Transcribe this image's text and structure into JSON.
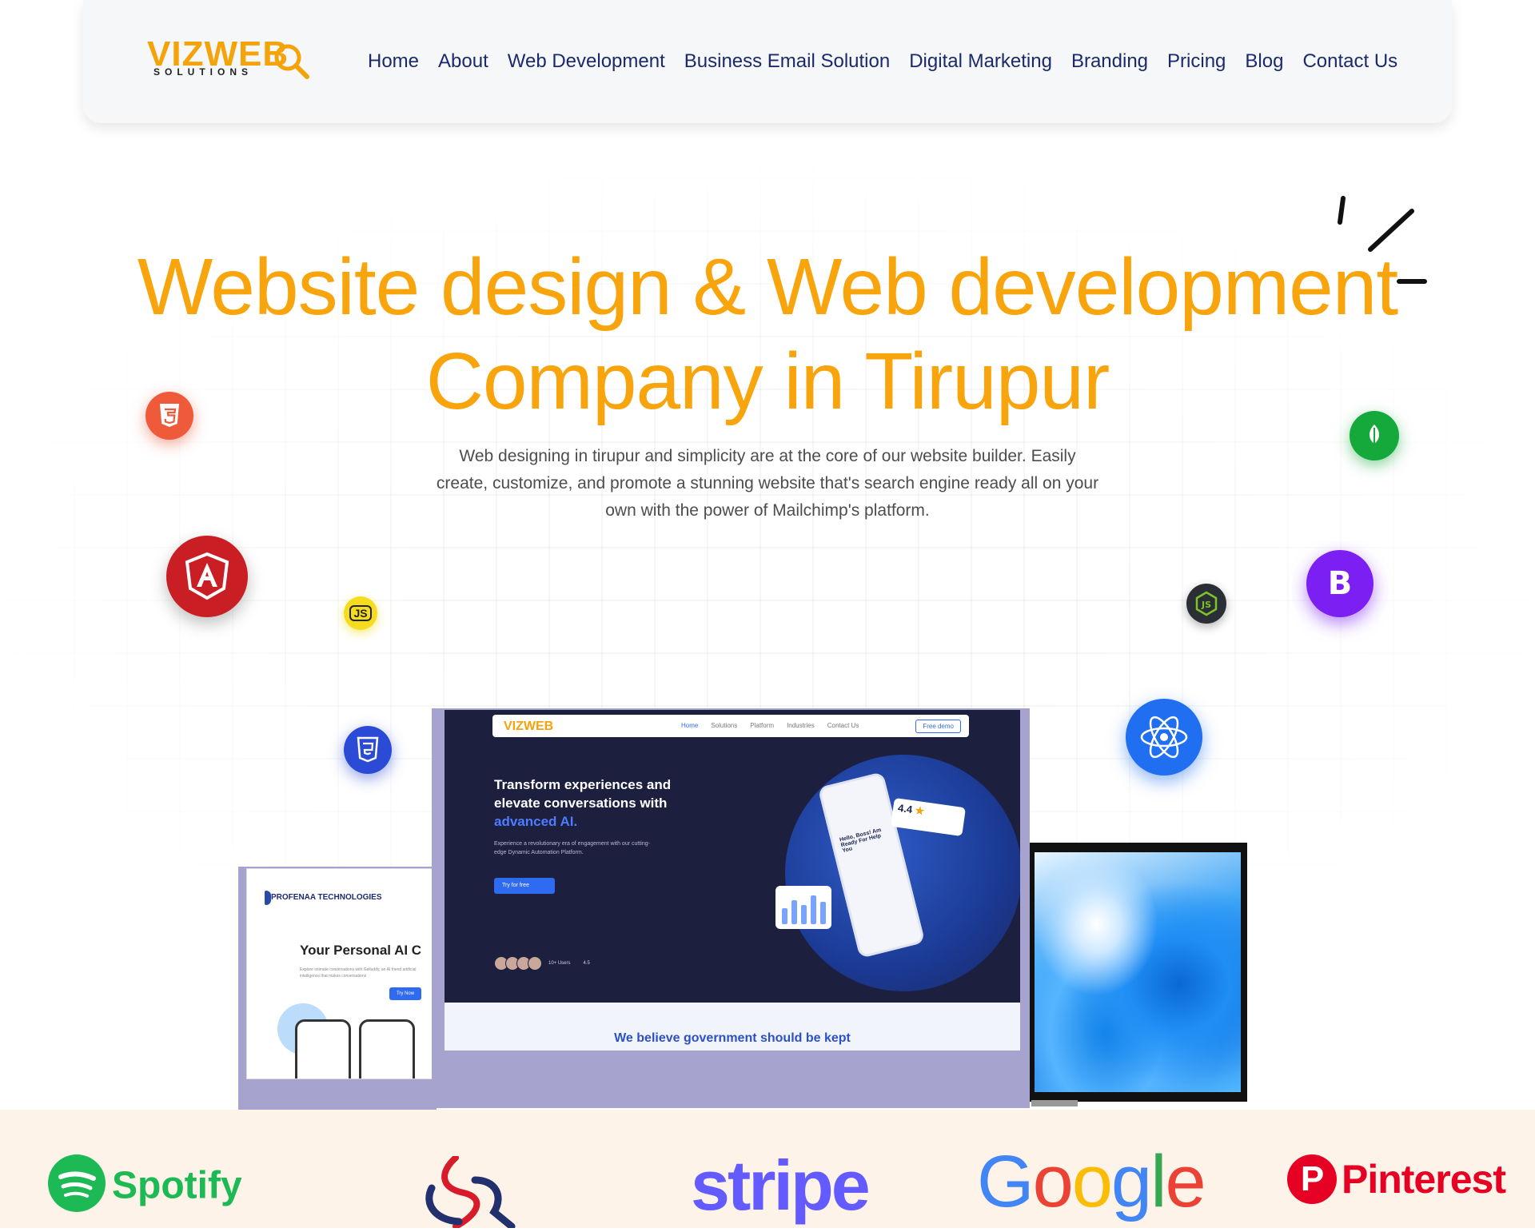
{
  "brand": {
    "logo_text": "VIZWEB",
    "logo_sub": "SOLUTIONS"
  },
  "nav": {
    "items": [
      {
        "label": "Home"
      },
      {
        "label": "About"
      },
      {
        "label": "Web Development"
      },
      {
        "label": "Business Email Solution"
      },
      {
        "label": "Digital Marketing"
      },
      {
        "label": "Branding"
      },
      {
        "label": "Pricing"
      },
      {
        "label": "Blog"
      },
      {
        "label": "Contact Us"
      }
    ]
  },
  "hero": {
    "title_line1": "Website design & Web development",
    "title_line2": "Company in Tirupur",
    "subtitle": "Web designing in tirupur and simplicity are at the core of our website builder. Easily create, customize, and promote a stunning website that's search engine ready all on your own with the power of Mailchimp's platform."
  },
  "tech_icons": {
    "html": "html5-icon",
    "angular": "angular-icon",
    "js": "js-icon",
    "css": "css3-icon",
    "mongodb": "mongodb-icon",
    "bootstrap": "bootstrap-icon",
    "nodejs": "nodejs-icon",
    "react": "react-icon",
    "bootstrap_letter": "B",
    "js_label": "JS",
    "mongodb_label": "mongoDB"
  },
  "laptop": {
    "logo": "VIZWEB",
    "links": [
      "Home",
      "Solutions",
      "Platform",
      "Industries",
      "Contact Us"
    ],
    "demo": "Free demo",
    "headline": "Transform experiences and elevate conversations with",
    "headline_accent": "advanced AI.",
    "small": "Experience a revolutionary era of engagement with our cutting-edge Dynamic Automation Platform.",
    "button": "Try for free",
    "phone_text": "Hello, Boss! Am Ready For Help You",
    "rating": "4.4",
    "faces_label": "10+ Users",
    "faces_rating": "4.5",
    "bottom_text": "We believe government should be kept"
  },
  "tablet": {
    "brand": "PROFENAA TECHNOLOGIES",
    "headline": "Your Personal AI C",
    "small": "Explore intimate conversations with Gelluddy, an AI friend artificial intelligence that makes conversations",
    "button": "Try Now"
  },
  "partners": [
    {
      "name": "Spotify"
    },
    {
      "name": "stripe"
    },
    {
      "name": "Google"
    },
    {
      "name": "Pinterest"
    }
  ],
  "colors": {
    "accent": "#f8a40d",
    "nav_text": "#1a2a6c",
    "strip_bg": "#fdf3e8",
    "laptop_bg": "#1d1f3e"
  }
}
